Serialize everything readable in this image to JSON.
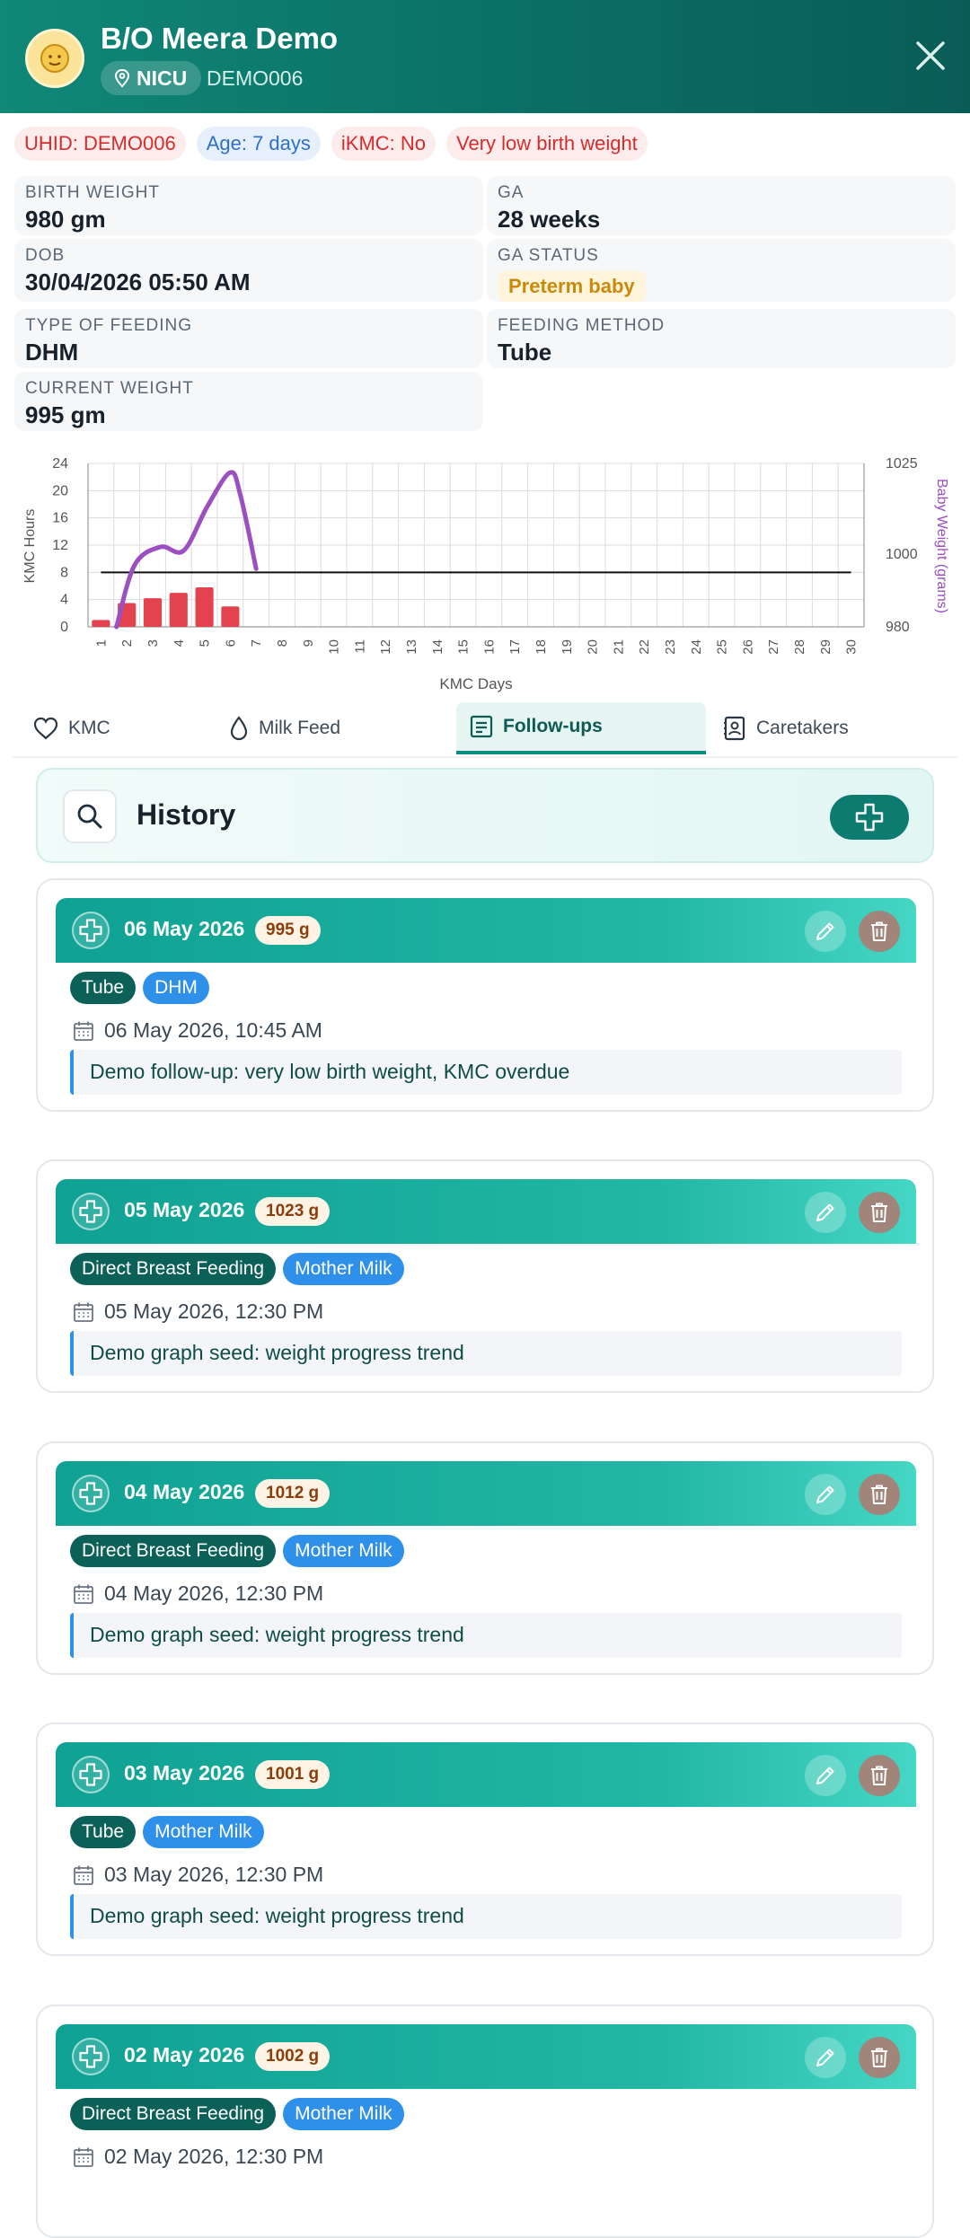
{
  "header": {
    "patient_name": "B/O Meera Demo",
    "unit": "NICU",
    "patient_code": "DEMO006",
    "icons": [
      "baby-avatar-icon",
      "location-pin-icon",
      "close-icon"
    ]
  },
  "tags": {
    "uhid": "UHID: DEMO006",
    "age": "Age: 7 days",
    "ikmc": "iKMC: No",
    "risk": "Very low birth weight"
  },
  "info": {
    "birth_weight_label": "BIRTH WEIGHT",
    "birth_weight": "980 gm",
    "ga_label": "GA",
    "ga": "28 weeks",
    "dob_label": "DOB",
    "dob": "30/04/2026 05:50 AM",
    "ga_status_label": "GA STATUS",
    "ga_status": "Preterm baby",
    "feeding_type_label": "TYPE OF FEEDING",
    "feeding_type": "DHM",
    "feeding_method_label": "FEEDING METHOD",
    "feeding_method": "Tube",
    "current_weight_label": "CURRENT WEIGHT",
    "current_weight": "995 gm"
  },
  "chart_data": {
    "type": "bar",
    "xlabel": "KMC Days",
    "ylabel": "KMC Hours",
    "y2label": "Baby Weight (grams)",
    "categories": [
      "1",
      "2",
      "3",
      "4",
      "5",
      "6",
      "7",
      "8",
      "9",
      "10",
      "11",
      "12",
      "13",
      "14",
      "15",
      "16",
      "17",
      "18",
      "19",
      "20",
      "21",
      "22",
      "23",
      "24",
      "25",
      "26",
      "27",
      "28",
      "29",
      "30"
    ],
    "ylim": [
      0,
      24
    ],
    "yticks": [
      0,
      4,
      8,
      12,
      16,
      20,
      24
    ],
    "y2lim": [
      980,
      1025
    ],
    "y2ticks": [
      980,
      1000,
      1025
    ],
    "series": [
      {
        "type": "bar",
        "axis": "left",
        "color": "#e2434f",
        "values": [
          1,
          3.5,
          4.2,
          5,
          5.8,
          3,
          0,
          0,
          0,
          0,
          0,
          0,
          0,
          0,
          0,
          0,
          0,
          0,
          0,
          0,
          0,
          0,
          0,
          0,
          0,
          0,
          0,
          0,
          0,
          0
        ]
      },
      {
        "type": "line",
        "axis": "left",
        "color": "#111111",
        "values_constant": 8,
        "x_range": [
          1,
          30
        ]
      },
      {
        "type": "line",
        "axis": "right",
        "color": "#9b4fc0",
        "points": [
          [
            1.6,
            980
          ],
          [
            2.3,
            997
          ],
          [
            3.3,
            1002
          ],
          [
            4.2,
            1001
          ],
          [
            5.1,
            1013
          ],
          [
            6.0,
            1022.5
          ],
          [
            6.4,
            1016
          ],
          [
            7.0,
            996
          ]
        ]
      }
    ],
    "grid": true
  },
  "tabs": [
    {
      "label": "KMC",
      "icon": "heart-icon"
    },
    {
      "label": "Milk Feed",
      "icon": "drop-icon"
    },
    {
      "label": "Follow-ups",
      "icon": "notes-icon",
      "active": true
    },
    {
      "label": "Caretakers",
      "icon": "contact-icon"
    }
  ],
  "history": {
    "title": "History",
    "icons": [
      "search-icon",
      "add-icon"
    ]
  },
  "followups": [
    {
      "date": "06 May 2026",
      "weight": "995 g",
      "method": "Tube",
      "milk": "DHM",
      "datetime": "06 May 2026, 10:45 AM",
      "note": "Demo follow-up: very low birth weight, KMC overdue"
    },
    {
      "date": "05 May 2026",
      "weight": "1023 g",
      "method": "Direct Breast Feeding",
      "milk": "Mother Milk",
      "datetime": "05 May 2026, 12:30 PM",
      "note": "Demo graph seed: weight progress trend"
    },
    {
      "date": "04 May 2026",
      "weight": "1012 g",
      "method": "Direct Breast Feeding",
      "milk": "Mother Milk",
      "datetime": "04 May 2026, 12:30 PM",
      "note": "Demo graph seed: weight progress trend"
    },
    {
      "date": "03 May 2026",
      "weight": "1001 g",
      "method": "Tube",
      "milk": "Mother Milk",
      "datetime": "03 May 2026, 12:30 PM",
      "note": "Demo graph seed: weight progress trend"
    },
    {
      "date": "02 May 2026",
      "weight": "1002 g",
      "method": "Direct Breast Feeding",
      "milk": "Mother Milk",
      "datetime": "02 May 2026, 12:30 PM",
      "note": ""
    }
  ],
  "colors": {
    "header": "#0b6f66",
    "accent": "#0c7b70",
    "bar": "#e2434f",
    "weight_line": "#9b4fc0",
    "milk_chip": "#2e90e8",
    "method_chip": "#0b6157"
  }
}
